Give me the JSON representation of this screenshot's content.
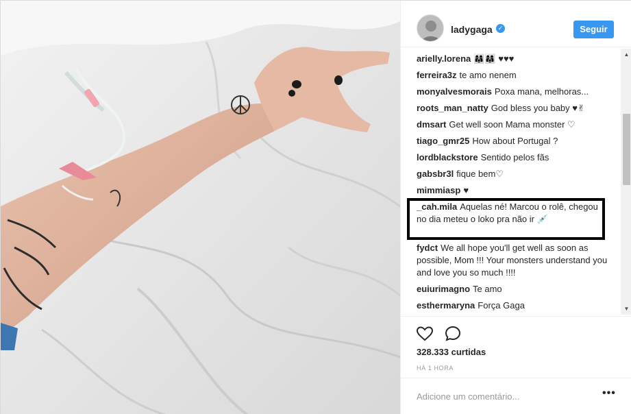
{
  "header": {
    "username": "ladygaga",
    "verified_mark": "✓",
    "follow_label": "Seguir"
  },
  "photo": {
    "description_icon": "hospital-iv-arm-photo"
  },
  "comments": [
    {
      "user": "arielly.lorena",
      "text": "👩‍👩‍👧👩‍👩‍👧 ♥♥♥"
    },
    {
      "user": "ferreira3z",
      "text": "te amo nenem"
    },
    {
      "user": "monyalvesmorais",
      "text": "Poxa mana, melhoras..."
    },
    {
      "user": "roots_man_natty",
      "text": "God bless you baby ♥✌"
    },
    {
      "user": "dmsart",
      "text": "Get well soon Mama monster ♡"
    },
    {
      "user": "tiago_gmr25",
      "text": "How about Portugal ?"
    },
    {
      "user": "lordblackstore",
      "text": "Sentido pelos fãs"
    },
    {
      "user": "gabsbr3l",
      "text": "fique bem♡"
    },
    {
      "user": "mimmiasp",
      "text": "♥"
    },
    {
      "user": "_cah.mila",
      "text": "Aquelas né! Marcou o rolê, chegou no dia meteu o loko pra não ir 💉"
    },
    {
      "user": "fydct",
      "text": "We all hope you'll get well as soon as possible, Mom !!! Your monsters understand you and love you so much !!!!"
    },
    {
      "user": "euiurimagno",
      "text": "Te amo"
    },
    {
      "user": "esthermaryna",
      "text": "Força Gaga"
    }
  ],
  "actions": {
    "like_icon": "heart-icon",
    "comment_icon": "comment-icon",
    "likes_text": "328.333 curtidas",
    "time_text": "HÁ 1 HORA"
  },
  "add_comment": {
    "placeholder": "Adicione um comentário...",
    "more_label": "•••"
  },
  "colors": {
    "accent": "#3897f0",
    "text": "#262626",
    "muted": "#999999",
    "border": "#efefef"
  }
}
